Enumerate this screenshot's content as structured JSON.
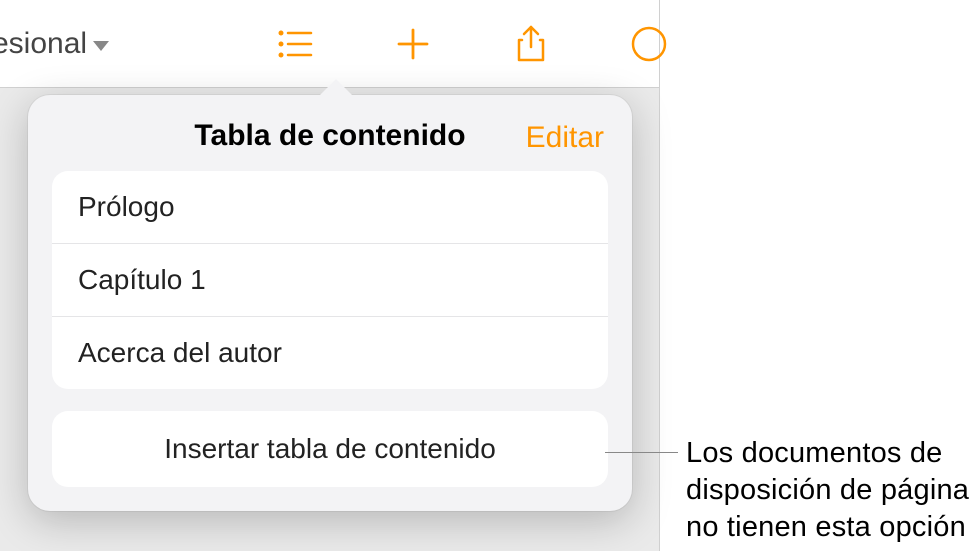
{
  "toolbar": {
    "doc_title_fragment": "esional"
  },
  "popover": {
    "title": "Tabla de contenido",
    "edit_label": "Editar",
    "items": [
      "Prólogo",
      "Capítulo 1",
      "Acerca del autor"
    ],
    "insert_label": "Insertar tabla de contenido"
  },
  "callout": {
    "text": "Los documentos de disposición de página no tienen esta opción"
  }
}
